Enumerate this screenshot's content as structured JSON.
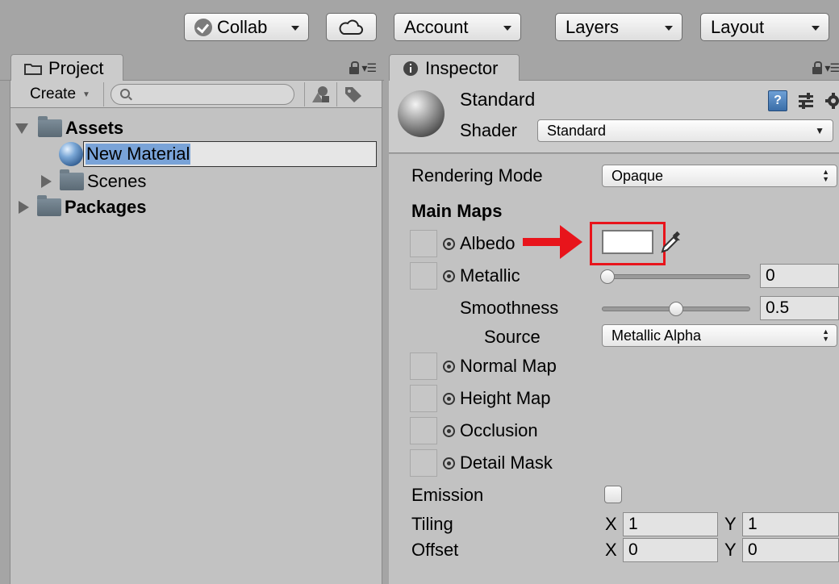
{
  "toolbar": {
    "collab_label": "Collab",
    "account_label": "Account",
    "layers_label": "Layers",
    "layout_label": "Layout"
  },
  "project": {
    "tab_label": "Project",
    "create_label": "Create",
    "search_placeholder": "",
    "tree": {
      "assets": "Assets",
      "new_material": "New Material",
      "scenes": "Scenes",
      "packages": "Packages"
    }
  },
  "inspector": {
    "tab_label": "Inspector",
    "title": "Standard",
    "shader_label": "Shader",
    "shader_value": "Standard",
    "rendering_mode_label": "Rendering Mode",
    "rendering_mode_value": "Opaque",
    "main_maps_label": "Main Maps",
    "albedo_label": "Albedo",
    "albedo_color": "#ffffff",
    "metallic_label": "Metallic",
    "metallic_value": "0",
    "smoothness_label": "Smoothness",
    "smoothness_value": "0.5",
    "source_label": "Source",
    "source_value": "Metallic Alpha",
    "normal_map_label": "Normal Map",
    "height_map_label": "Height Map",
    "occlusion_label": "Occlusion",
    "detail_mask_label": "Detail Mask",
    "emission_label": "Emission",
    "tiling_label": "Tiling",
    "offset_label": "Offset",
    "x_label": "X",
    "y_label": "Y",
    "tiling_x": "1",
    "tiling_y": "1",
    "offset_x": "0",
    "offset_y": "0"
  },
  "annotation": {
    "color": "#e8141b"
  }
}
